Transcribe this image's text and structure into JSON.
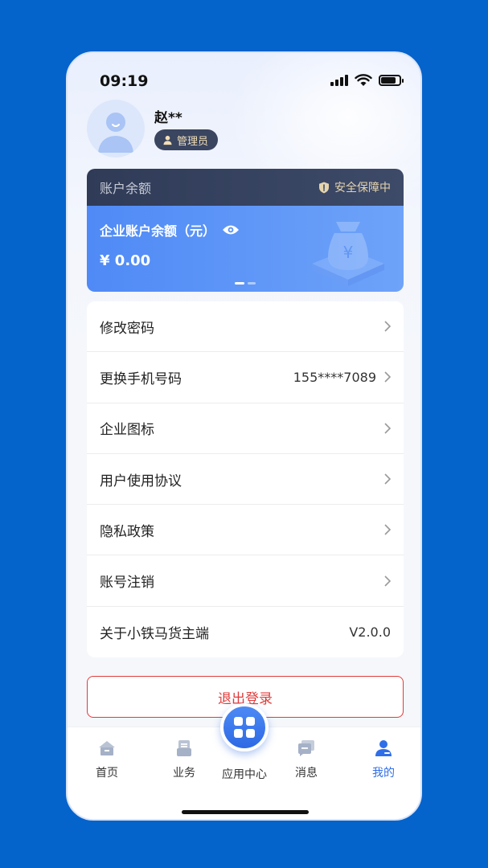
{
  "status_bar": {
    "time": "09:19"
  },
  "profile": {
    "username": "赵**",
    "role": "管理员"
  },
  "balance_card": {
    "title": "账户余额",
    "secure_text": "安全保障中",
    "label": "企业账户余额（元）",
    "amount": "¥ 0.00",
    "page_indicator": {
      "pages": 2,
      "active": 1
    }
  },
  "menu": {
    "change_password": "修改密码",
    "change_phone": "更换手机号码",
    "phone_value": "155****7089",
    "company_logo": "企业图标",
    "user_agreement": "用户使用协议",
    "privacy_policy": "隐私政策",
    "account_cancel": "账号注销",
    "about": "关于小铁马货主端",
    "version": "V2.0.0"
  },
  "logout_label": "退出登录",
  "tabbar": {
    "home": "首页",
    "business": "业务",
    "app_center": "应用中心",
    "messages": "消息",
    "mine": "我的"
  },
  "colors": {
    "background": "#0563cc",
    "accent": "#2f6ee9",
    "danger": "#e03b3b",
    "card_head": "#2f3b57",
    "card_body": "#4f8af6"
  }
}
